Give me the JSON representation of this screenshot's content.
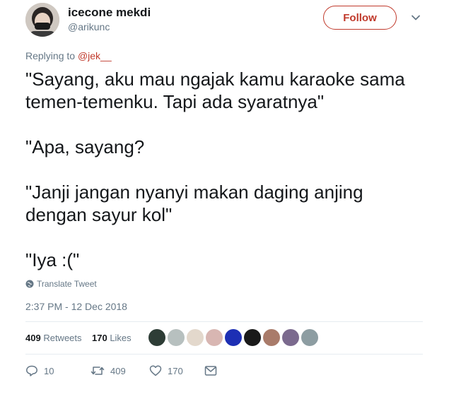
{
  "user": {
    "name": "icecone mekdi",
    "handle": "@arikunc"
  },
  "follow_label": "Follow",
  "replying": {
    "prefix": "Replying to",
    "mention": "@jek__"
  },
  "tweet_lines": [
    "\"Sayang, aku mau ngajak kamu karaoke sama",
    "temen-temenku. Tapi ada syaratnya\"",
    "\"Apa, sayang?",
    "\"Janji jangan nyanyi makan daging anjing",
    "dengan sayur kol\"",
    "\"Iya :(\""
  ],
  "translate_label": "Translate Tweet",
  "timestamp": "2:37 PM - 12 Dec 2018",
  "stats": {
    "retweets_count": "409",
    "retweets_label": "Retweets",
    "likes_count": "170",
    "likes_label": "Likes"
  },
  "liker_avatars": [
    "#2e3d36",
    "#b7c0bf",
    "#e3d8cc",
    "#d8b6b2",
    "#1d2fb4",
    "#1a1a1a",
    "#a97b6a",
    "#7b6a8e",
    "#8d9da2"
  ],
  "actions": {
    "reply_count": "10",
    "retweet_count": "409",
    "like_count": "170"
  },
  "colors": {
    "accent": "#c0392b",
    "muted": "#657786",
    "text": "#14171a"
  },
  "icons": [
    "avatar",
    "chevron-down-icon",
    "globe-icon",
    "reply-icon",
    "retweet-icon",
    "heart-icon",
    "message-icon"
  ]
}
